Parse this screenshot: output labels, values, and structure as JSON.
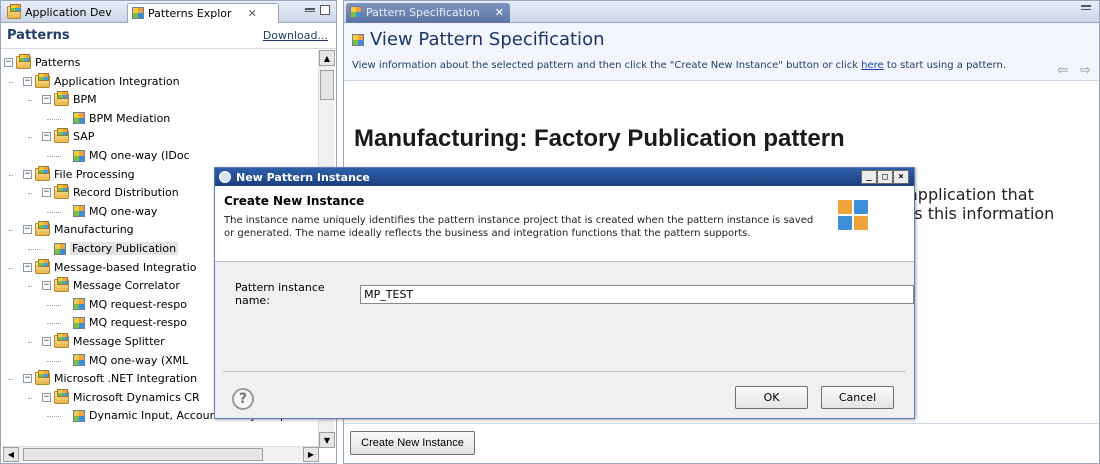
{
  "left_panel": {
    "tabs": [
      {
        "label": "Application Dev"
      },
      {
        "label": "Patterns Explor"
      }
    ],
    "header": {
      "title": "Patterns",
      "download_link": "Download..."
    },
    "tree": [
      {
        "label": "Patterns",
        "depth": 0,
        "type": "folder",
        "expander": "−"
      },
      {
        "label": "Application Integration",
        "depth": 1,
        "type": "folder",
        "expander": "−"
      },
      {
        "label": "BPM",
        "depth": 2,
        "type": "folder",
        "expander": "−"
      },
      {
        "label": "BPM Mediation",
        "depth": 3,
        "type": "pattern"
      },
      {
        "label": "SAP",
        "depth": 2,
        "type": "folder",
        "expander": "−"
      },
      {
        "label": "MQ one-way (IDoc",
        "depth": 3,
        "type": "pattern"
      },
      {
        "label": "File Processing",
        "depth": 1,
        "type": "folder",
        "expander": "−"
      },
      {
        "label": "Record Distribution",
        "depth": 2,
        "type": "folder",
        "expander": "−"
      },
      {
        "label": "MQ one-way",
        "depth": 3,
        "type": "pattern"
      },
      {
        "label": "Manufacturing",
        "depth": 1,
        "type": "folder",
        "expander": "−"
      },
      {
        "label": "Factory Publication",
        "depth": 2,
        "type": "pattern",
        "selected": true
      },
      {
        "label": "Message-based Integratio",
        "depth": 1,
        "type": "folder",
        "expander": "−"
      },
      {
        "label": "Message Correlator",
        "depth": 2,
        "type": "folder",
        "expander": "−"
      },
      {
        "label": "MQ request-respo",
        "depth": 3,
        "type": "pattern"
      },
      {
        "label": "MQ request-respo",
        "depth": 3,
        "type": "pattern"
      },
      {
        "label": "Message Splitter",
        "depth": 2,
        "type": "folder",
        "expander": "−"
      },
      {
        "label": "MQ one-way (XML",
        "depth": 3,
        "type": "pattern"
      },
      {
        "label": "Microsoft .NET Integration",
        "depth": 1,
        "type": "folder",
        "expander": "−"
      },
      {
        "label": "Microsoft Dynamics CR",
        "depth": 2,
        "type": "folder",
        "expander": "−"
      },
      {
        "label": "Dynamic Input, Account Entity Output",
        "depth": 3,
        "type": "pattern"
      }
    ]
  },
  "right_panel": {
    "tab_label": "Pattern Specification",
    "title": "View Pattern Specification",
    "description_before": "View information about the selected pattern and then click the \"Create New Instance\" button or click ",
    "description_link": "here",
    "description_after": " to start using a pattern.",
    "content_title": "Manufacturing: Factory Publication pattern",
    "content_text_line1": "application that",
    "content_text_line2": "ts this information",
    "create_button": "Create New Instance",
    "nav_arrows": "⇦ ⇨"
  },
  "dialog": {
    "title": "New Pattern Instance",
    "heading": "Create New Instance",
    "description": "The instance name uniquely identifies the pattern instance project that is created when the pattern instance is saved or generated.  The name ideally reflects the business and integration functions that the pattern supports.",
    "field_label": "Pattern instance name:",
    "field_value": "MP_TEST",
    "ok_label": "OK",
    "cancel_label": "Cancel",
    "help_glyph": "?",
    "controls": {
      "minimize": "_",
      "maximize": "□",
      "close": "×"
    }
  },
  "colors": {
    "title_blue": "#1c3566",
    "dialog_titlebar": "#1b3f80",
    "logo": [
      "#f0a33a",
      "#3c8fd8",
      "#3c8fd8",
      "#f0a33a"
    ]
  }
}
